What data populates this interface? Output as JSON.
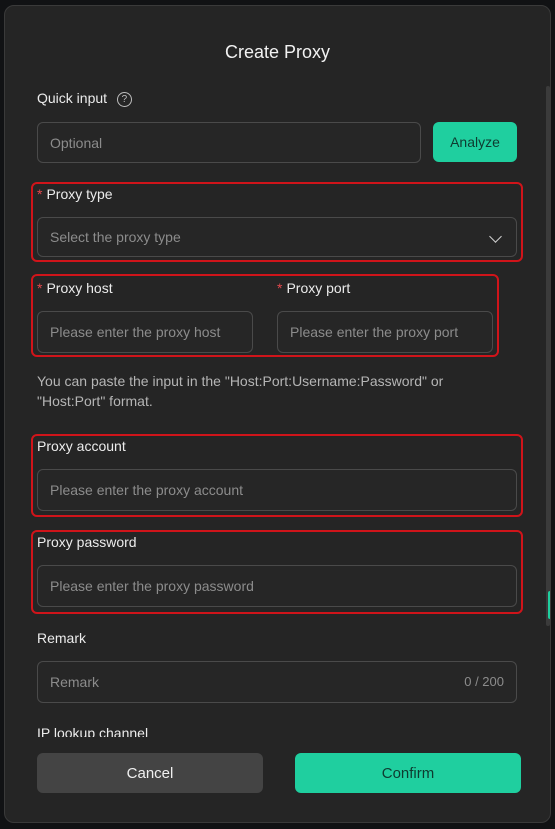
{
  "dialog": {
    "title": "Create Proxy",
    "quick_input": {
      "label": "Quick input",
      "placeholder": "Optional",
      "analyze_label": "Analyze"
    },
    "proxy_type": {
      "required_mark": "*",
      "label": "Proxy type",
      "placeholder": "Select the proxy type"
    },
    "proxy_host": {
      "required_mark": "*",
      "label": "Proxy host",
      "placeholder": "Please enter the proxy host"
    },
    "proxy_port": {
      "required_mark": "*",
      "label": "Proxy port",
      "placeholder": "Please enter the proxy port"
    },
    "hint": "You can paste the input in the \"Host:Port:Username:Password\" or \"Host:Port\" format.",
    "proxy_account": {
      "label": "Proxy account",
      "placeholder": "Please enter the proxy account"
    },
    "proxy_password": {
      "label": "Proxy password",
      "placeholder": "Please enter the proxy password"
    },
    "remark": {
      "label": "Remark",
      "placeholder": "Remark",
      "counter": "0 / 200"
    },
    "ip_lookup": {
      "label": "IP lookup channel"
    },
    "footer": {
      "cancel_label": "Cancel",
      "confirm_label": "Confirm"
    }
  },
  "colors": {
    "accent": "#1fcf9f",
    "highlight": "#d0141a",
    "background": "#252525"
  }
}
